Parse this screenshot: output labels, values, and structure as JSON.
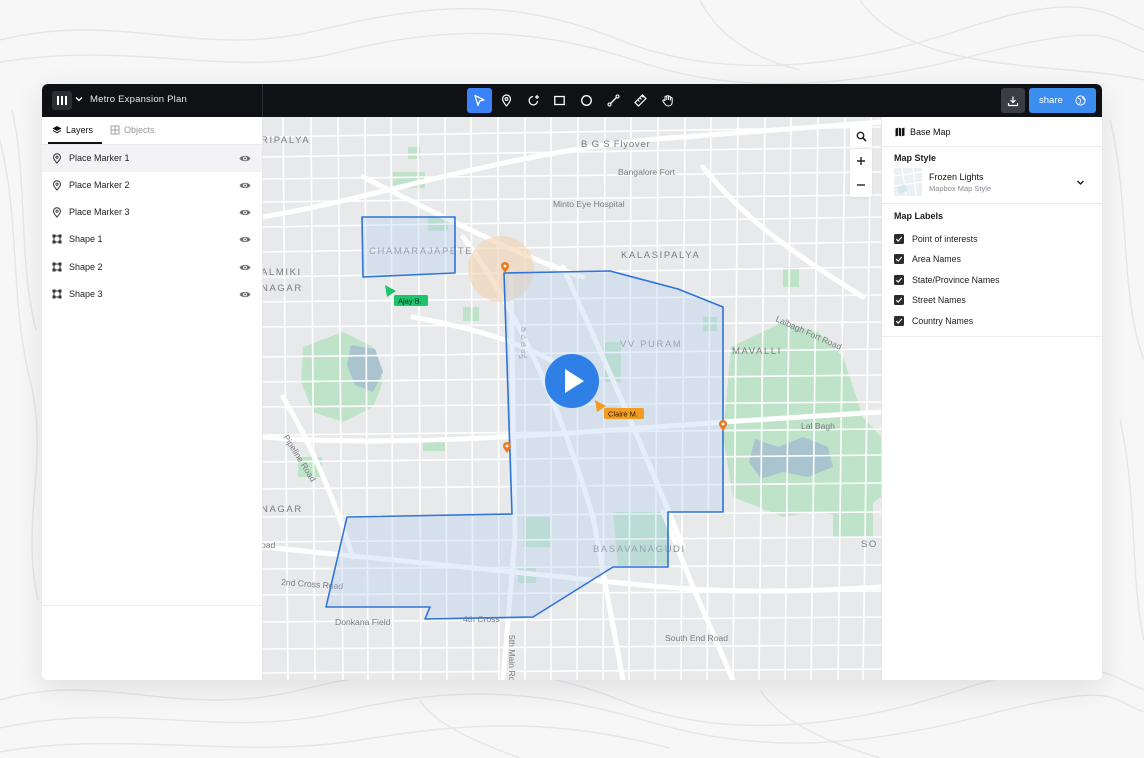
{
  "app": {
    "title": "Metro Expansion Plan"
  },
  "toolbar": {
    "tools": [
      "select-tool",
      "marker-tool",
      "lasso-tool",
      "rectangle-tool",
      "circle-tool",
      "line-tool",
      "measure-tool",
      "pan-tool"
    ],
    "active_tool": "select-tool",
    "share_label": "share"
  },
  "left_panel": {
    "tabs": [
      {
        "label": "Layers",
        "active": true
      },
      {
        "label": "Objects",
        "active": false
      }
    ],
    "layers": [
      {
        "label": "Place Marker 1",
        "icon": "pin-icon",
        "selected": true
      },
      {
        "label": "Place Marker 2",
        "icon": "pin-icon",
        "selected": false
      },
      {
        "label": "Place Marker 3",
        "icon": "pin-icon",
        "selected": false
      },
      {
        "label": "Shape 1",
        "icon": "shape-icon",
        "selected": false
      },
      {
        "label": "Shape 2",
        "icon": "shape-icon",
        "selected": false
      },
      {
        "label": "Shape 3",
        "icon": "shape-icon",
        "selected": false
      }
    ]
  },
  "map": {
    "labels": {
      "ripalya": "RIPALYA",
      "bgs_flyover": "B G S Flyover",
      "bangalore_fort": "Bangalore Fort",
      "minto": "Minto Eye Hospital",
      "chamarajapete": "CHAMARAJAPETE",
      "kalasipalya": "KALASIPALYA",
      "valmiki": "ALMIKI",
      "nagar1": "NAGAR",
      "vv_puram": "VV PURAM",
      "mavalli": "MAVALLI",
      "lalbagh_fort": "Lalbagh Fort Road",
      "lal_bagh": "Lal Bagh",
      "pipeline": "Pipeline Road",
      "nagar2": "NAGAR",
      "basavanagudi": "BASAVANAGUDI",
      "road": "oad",
      "cross2": "2nd Cross Road",
      "donkana": "Donkana Field",
      "cross4": "4th Cross",
      "main5": "5th Main Ro",
      "south_end": "South End Road",
      "so": "SO",
      "vertical_kannada": "ಡಿ ವಿ ಜಿ ರಸ್ತೆ"
    },
    "users": [
      {
        "name": "Ajay B.",
        "color": "#1ec46b"
      },
      {
        "name": "Claire M.",
        "color": "#f39c23"
      }
    ],
    "polygon_color": "#2f74d8",
    "marker_color": "#ea7b24"
  },
  "right_panel": {
    "base_map_label": "Base Map",
    "map_style_heading": "Map Style",
    "style_name": "Frozen Lights",
    "style_sub": "Mapbox Map Style",
    "map_labels_heading": "Map Labels",
    "label_options": [
      {
        "label": "Point of interests",
        "checked": true
      },
      {
        "label": "Area Names",
        "checked": true
      },
      {
        "label": "State/Province Names",
        "checked": true
      },
      {
        "label": "Street Names",
        "checked": true
      },
      {
        "label": "Country Names",
        "checked": true
      }
    ]
  }
}
